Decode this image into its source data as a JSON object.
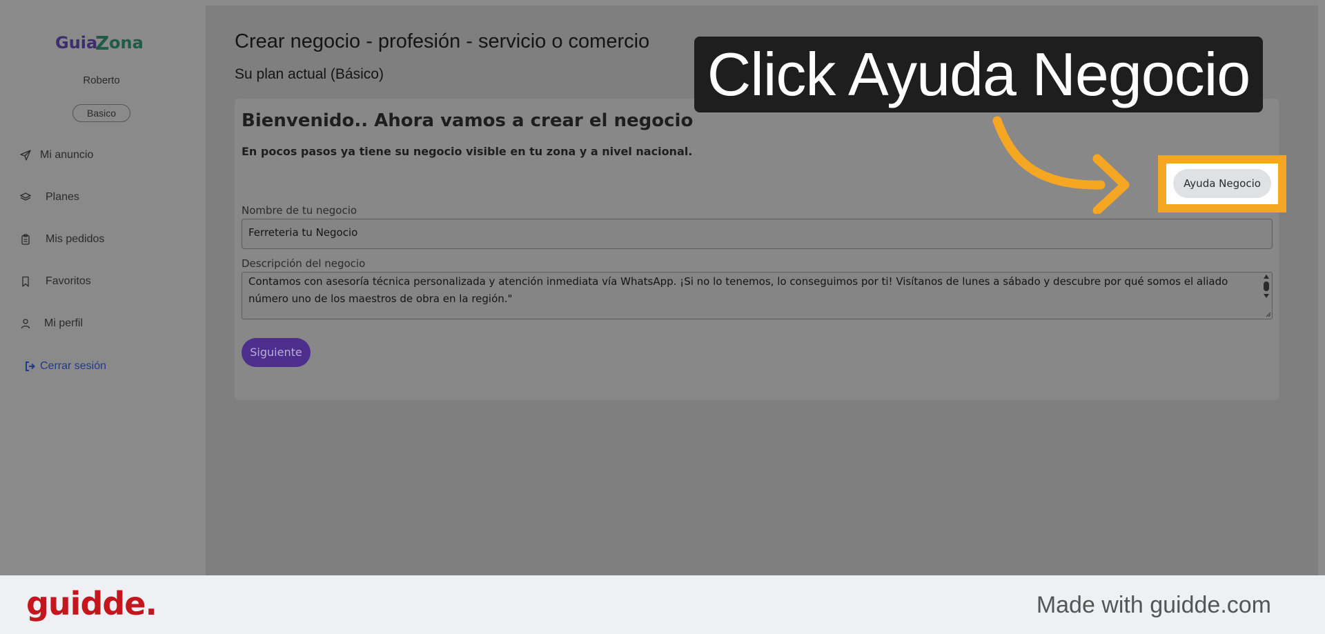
{
  "sidebar": {
    "logo_text": "GuiaZona",
    "username": "Roberto",
    "plan_badge": "Basico",
    "items": [
      {
        "label": "Mi anuncio",
        "icon": "send-icon"
      },
      {
        "label": "Planes",
        "icon": "layers-icon"
      },
      {
        "label": "Mis pedidos",
        "icon": "clipboard-icon"
      },
      {
        "label": "Favoritos",
        "icon": "bookmark-icon"
      },
      {
        "label": "Mi perfil",
        "icon": "user-icon"
      }
    ],
    "logout": {
      "label": "Cerrar sesión",
      "icon": "sign-out-icon"
    }
  },
  "main": {
    "title": "Crear negocio - profesión - servicio o comercio",
    "plan_line": "Su plan actual (Básico)",
    "welcome": "Bienvenido.. Ahora vamos a crear el negocio",
    "subtitle": "En pocos pasos ya tiene su negocio visible en tu zona y a nivel nacional.",
    "help_button": "Ayuda Negocio",
    "name_field": {
      "label": "Nombre de tu negocio",
      "value": "Ferreteria tu Negocio"
    },
    "description_field": {
      "label": "Descripción del negocio",
      "value": "Contamos con asesoría técnica personalizada y atención inmediata vía WhatsApp. ¡Si no lo tenemos, lo conseguimos por ti! Visítanos de lunes a sábado y descubre por qué somos el aliado número uno de los maestros de obra en la región.\""
    },
    "next_button": "Siguiente"
  },
  "overlay": {
    "callout": "Click Ayuda Negocio",
    "accent": "#f5a623"
  },
  "footer": {
    "logo": "guidde.",
    "made_with": "Made with guidde.com"
  },
  "colors": {
    "brand_purple": "#4d2e8c",
    "footer_red": "#c4161c"
  }
}
